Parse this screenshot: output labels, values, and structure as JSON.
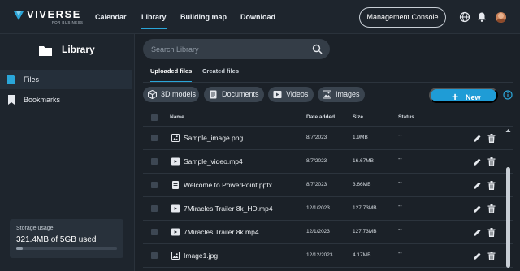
{
  "brand": {
    "name": "VIVERSE",
    "tagline": "FOR BUSINESS"
  },
  "nav": [
    {
      "label": "Calendar",
      "active": false
    },
    {
      "label": "Library",
      "active": true
    },
    {
      "label": "Building map",
      "active": false
    },
    {
      "label": "Download",
      "active": false
    }
  ],
  "header": {
    "management_label": "Management Console",
    "icons": [
      "globe-icon",
      "bell-icon",
      "avatar"
    ]
  },
  "sidebar": {
    "title": "Library",
    "items": [
      {
        "label": "Files",
        "icon": "file-icon",
        "active": true
      },
      {
        "label": "Bookmarks",
        "icon": "bookmark-icon",
        "active": false
      }
    ],
    "storage": {
      "label": "Storage usage",
      "value": "321.4MB of 5GB used",
      "fraction": 0.064
    }
  },
  "search": {
    "placeholder": "Search Library",
    "value": ""
  },
  "tabs": [
    {
      "label": "Uploaded files",
      "active": true
    },
    {
      "label": "Created files",
      "active": false
    }
  ],
  "filters": [
    {
      "label": "3D models",
      "icon": "cube-icon"
    },
    {
      "label": "Documents",
      "icon": "document-icon"
    },
    {
      "label": "Videos",
      "icon": "video-icon"
    },
    {
      "label": "Images",
      "icon": "image-icon"
    }
  ],
  "new_label": "New",
  "table": {
    "columns": [
      "Name",
      "Date added",
      "Size",
      "Status"
    ],
    "rows": [
      {
        "type": "image",
        "name": "Sample_image.png",
        "date": "8/7/2023",
        "size": "1.9MB",
        "status": "--"
      },
      {
        "type": "video",
        "name": "Sample_video.mp4",
        "date": "8/7/2023",
        "size": "16.67MB",
        "status": "--"
      },
      {
        "type": "document",
        "name": "Welcome to PowerPoint.pptx",
        "date": "8/7/2023",
        "size": "3.66MB",
        "status": "--"
      },
      {
        "type": "video",
        "name": "7Miracles Trailer 8k_HD.mp4",
        "date": "12/1/2023",
        "size": "127.73MB",
        "status": "--"
      },
      {
        "type": "video",
        "name": "7Miracles Trailer 8k.mp4",
        "date": "12/1/2023",
        "size": "127.73MB",
        "status": "--"
      },
      {
        "type": "image",
        "name": "Image1.jpg",
        "date": "12/12/2023",
        "size": "4.17MB",
        "status": "--"
      }
    ]
  },
  "colors": {
    "accent": "#1f9cd6",
    "background": "#1b2128",
    "panel": "#1e252d"
  }
}
